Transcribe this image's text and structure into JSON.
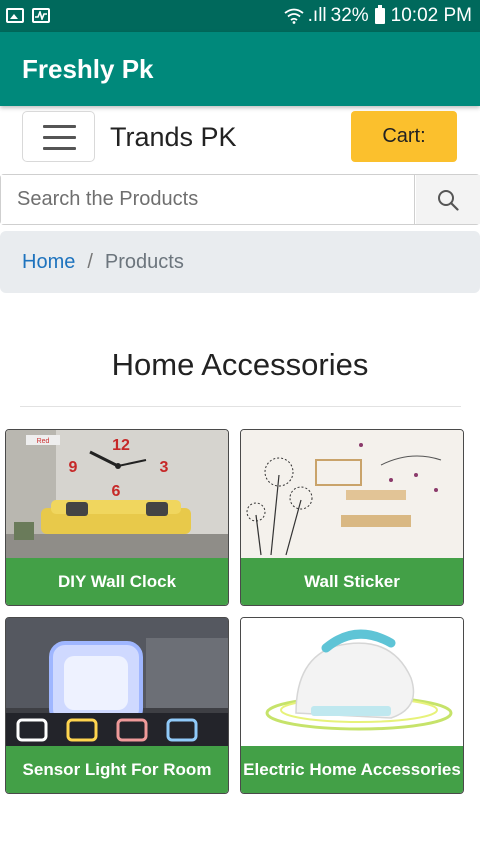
{
  "status_bar": {
    "signal": ".ıll",
    "battery_percent": "32%",
    "time": "10:02 PM"
  },
  "app_bar": {
    "title": "Freshly Pk"
  },
  "nav": {
    "brand": "Trands PK",
    "cart_label": "Cart:"
  },
  "search": {
    "placeholder": "Search the Products"
  },
  "breadcrumb": {
    "home": "Home",
    "separator": "/",
    "current": "Products"
  },
  "section": {
    "title": "Home Accessories"
  },
  "products": [
    {
      "name": "DIY Wall Clock"
    },
    {
      "name": "Wall Sticker"
    },
    {
      "name": "Sensor Light For Room"
    },
    {
      "name": "Electric Home Accessories"
    }
  ],
  "colors": {
    "status_bar": "#00695c",
    "app_bar": "#00897b",
    "cart_button": "#fbc02d",
    "product_label": "#43a047",
    "link": "#1e73be"
  },
  "icons": [
    "image-icon",
    "activity-icon",
    "wifi-icon",
    "battery-icon",
    "menu-icon",
    "search-icon"
  ]
}
